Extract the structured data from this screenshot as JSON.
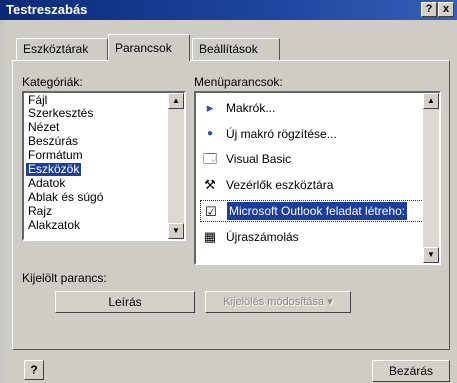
{
  "window": {
    "title": "Testreszabás",
    "help_btn": "?",
    "close_btn": "x"
  },
  "tabs": [
    {
      "label": "Eszköztárak"
    },
    {
      "label": "Parancsok"
    },
    {
      "label": "Beállítások"
    }
  ],
  "categories": {
    "label": "Kategóriák:",
    "items": [
      "Fájl",
      "Szerkesztés",
      "Nézet",
      "Beszúrás",
      "Formátum",
      "Eszközök",
      "Adatok",
      "Ablak és súgó",
      "Rajz",
      "Alakzatok"
    ],
    "selected": "Eszközök"
  },
  "commands": {
    "label": "Menüparancsok:",
    "items": [
      {
        "icon": "arrow-right-icon",
        "glyph": "▸",
        "label": "Makrók..."
      },
      {
        "icon": "record-dot-icon",
        "glyph": "●",
        "label": "Új makró rögzítése..."
      },
      {
        "icon": "visual-basic-icon",
        "glyph": "🗔",
        "label": "Visual Basic"
      },
      {
        "icon": "tools-icon",
        "glyph": "⚒",
        "label": "Vezérlők eszköztára"
      },
      {
        "icon": "checkbox-icon",
        "glyph": "☑",
        "label": "Microsoft Outlook feladat létreho:"
      },
      {
        "icon": "calculator-icon",
        "glyph": "▦",
        "label": "Újraszámolás"
      }
    ],
    "selected": "Microsoft Outlook feladat létreho:"
  },
  "selected_command": {
    "label": "Kijelölt parancs:",
    "description_btn": "Leírás",
    "modify_btn": "Kijelölés módosítása ▾"
  },
  "footer": {
    "help_icon": "?",
    "close_btn": "Bezárás"
  }
}
